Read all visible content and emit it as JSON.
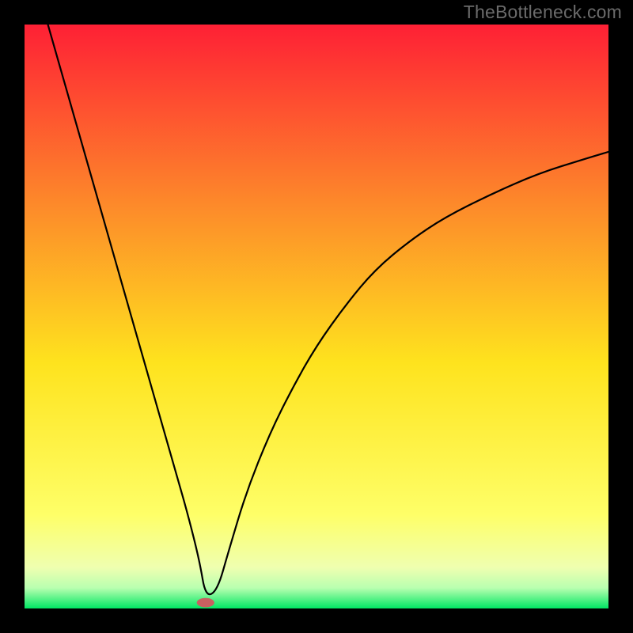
{
  "watermark": "TheBottleneck.com",
  "chart_data": {
    "type": "line",
    "title": "",
    "xlabel": "",
    "ylabel": "",
    "xlim": [
      0,
      100
    ],
    "ylim": [
      0,
      100
    ],
    "grid": false,
    "legend": false,
    "background_gradient": {
      "top": "#fe2035",
      "q1": "#fd8a2a",
      "mid": "#fee31e",
      "q3": "#feff68",
      "bottom": "#00e763"
    },
    "series": [
      {
        "name": "bottleneck-curve",
        "x": [
          4,
          6,
          8,
          10,
          12,
          14,
          16,
          18,
          20,
          22,
          24,
          26,
          28,
          30,
          31,
          33,
          35,
          38,
          42,
          46,
          50,
          55,
          60,
          66,
          72,
          80,
          88,
          96,
          100
        ],
        "y": [
          100,
          93,
          86,
          79,
          72,
          65,
          58,
          51,
          44,
          37,
          30,
          23,
          16,
          8,
          2,
          3,
          10,
          20,
          30,
          38,
          45,
          52,
          58,
          63,
          67,
          71,
          74.5,
          77,
          78.2
        ]
      }
    ],
    "marker": {
      "name": "optimal-point",
      "x": 31,
      "y": 1,
      "rx": 1.5,
      "ry": 0.8,
      "color": "#c86060"
    }
  }
}
